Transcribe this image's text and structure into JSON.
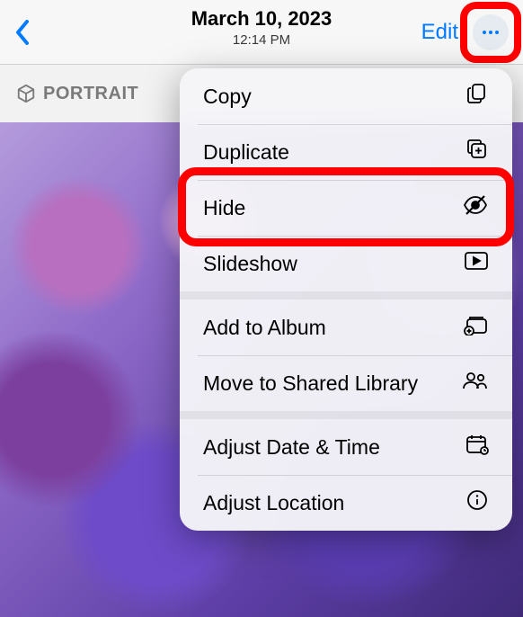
{
  "header": {
    "date": "March 10, 2023",
    "time": "12:14 PM",
    "edit": "Edit"
  },
  "badge": {
    "portrait": "PORTRAIT"
  },
  "menu": {
    "copy": "Copy",
    "duplicate": "Duplicate",
    "hide": "Hide",
    "slideshow": "Slideshow",
    "add_to_album": "Add to Album",
    "move_shared": "Move to Shared Library",
    "adjust_datetime": "Adjust Date & Time",
    "adjust_location": "Adjust Location"
  },
  "colors": {
    "accent": "#007aff",
    "highlight": "#ff0000"
  }
}
